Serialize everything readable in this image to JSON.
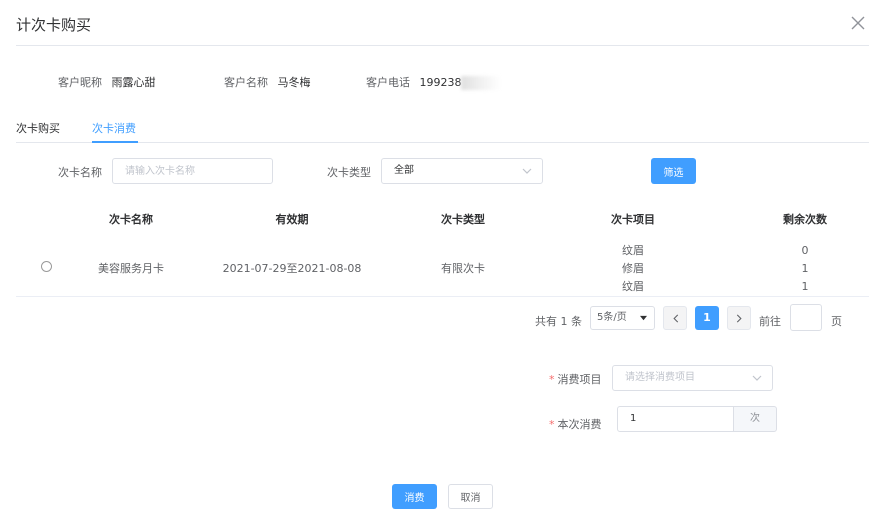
{
  "dialog": {
    "title": "计次卡购买"
  },
  "customer": {
    "nickname_label": "客户昵称",
    "nickname_value": "雨露心甜",
    "name_label": "客户名称",
    "name_value": "马冬梅",
    "phone_label": "客户电话",
    "phone_value": "199238"
  },
  "tabs": [
    {
      "label": "次卡购买",
      "active": false
    },
    {
      "label": "次卡消费",
      "active": true
    }
  ],
  "filter": {
    "card_name_label": "次卡名称",
    "card_name_placeholder": "请输入次卡名称",
    "card_type_label": "次卡类型",
    "card_type_value": "全部",
    "filter_button": "筛选"
  },
  "table": {
    "columns": [
      "次卡名称",
      "有效期",
      "次卡类型",
      "次卡项目",
      "剩余次数"
    ],
    "rows": [
      {
        "name": "美容服务月卡",
        "validity": "2021-07-29至2021-08-08",
        "type": "有限次卡",
        "items": [
          "纹眉",
          "修眉",
          "纹眉"
        ],
        "remaining": [
          "0",
          "1",
          "1"
        ]
      }
    ]
  },
  "pagination": {
    "total_text": "共有 1 条",
    "page_size": "5条/页",
    "current_page": "1",
    "goto_label": "前往",
    "page_unit": "页"
  },
  "form": {
    "item_label": "消费项目",
    "item_placeholder": "请选择消费项目",
    "count_label": "本次消费",
    "count_value": "1",
    "count_unit": "次"
  },
  "footer": {
    "consume_button": "消费",
    "cancel_button": "取消"
  },
  "colors": {
    "primary": "#409eff",
    "required": "#f56c6c"
  }
}
